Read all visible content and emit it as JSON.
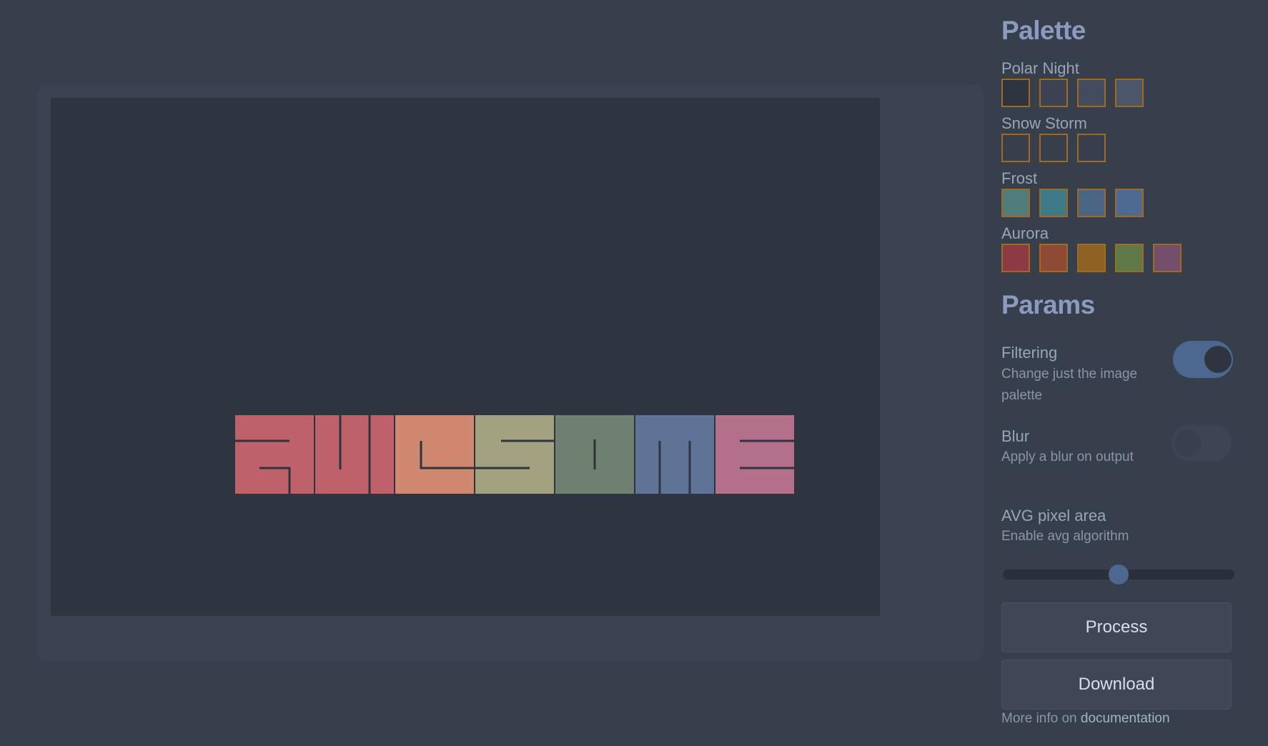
{
  "palette": {
    "title": "Palette",
    "groups": [
      {
        "name": "Polar Night",
        "colors": [
          "#2e3440",
          "#3b4252",
          "#434c5e",
          "#4c566a"
        ]
      },
      {
        "name": "Snow Storm",
        "colors": [
          "#373e4c",
          "#373e4c",
          "#373e4c"
        ]
      },
      {
        "name": "Frost",
        "colors": [
          "#4f7d7b",
          "#3b7a86",
          "#4a6584",
          "#4c6a92"
        ]
      },
      {
        "name": "Aurora",
        "colors": [
          "#8e3a44",
          "#8e4a34",
          "#8e6222",
          "#5f7a48",
          "#744f6b"
        ]
      }
    ]
  },
  "params": {
    "title": "Params",
    "filtering": {
      "label": "Filtering",
      "description": "Change just the image palette",
      "enabled": true
    },
    "blur": {
      "label": "Blur",
      "description": "Apply a blur on output",
      "enabled": false
    },
    "avg": {
      "label": "AVG pixel area",
      "description": "Enable avg algorithm",
      "value": 0.5
    }
  },
  "buttons": {
    "process": "Process",
    "download": "Download"
  },
  "footer": {
    "prefix": "More info on ",
    "link": "documentation"
  },
  "preview": {
    "word": "AWESOME",
    "letter_colors": [
      "#bf616a",
      "#bf616a",
      "#d08770",
      "#a3a280",
      "#6e8070",
      "#5e7396",
      "#b4708a"
    ]
  }
}
